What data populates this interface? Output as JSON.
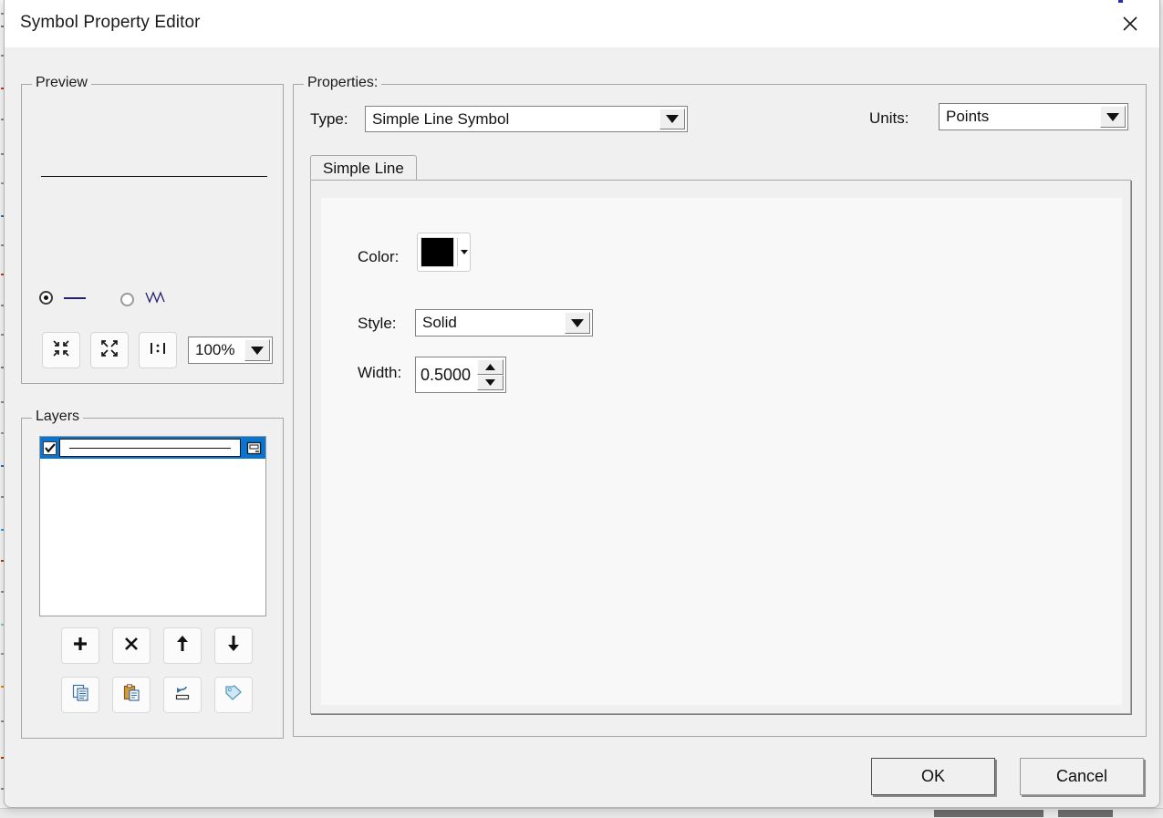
{
  "window": {
    "title": "Symbol Property Editor",
    "close_icon": "close-icon"
  },
  "preview": {
    "legend": "Preview",
    "line_color": "#111111",
    "options": [
      {
        "id": "straight-line",
        "icon": "line-glyph",
        "selected": true
      },
      {
        "id": "zigzag-line",
        "icon": "zigzag-glyph",
        "selected": false
      }
    ],
    "tools": [
      {
        "id": "zoom-out-button",
        "icon": "arrows-inward-icon"
      },
      {
        "id": "zoom-in-button",
        "icon": "arrows-outward-icon"
      },
      {
        "id": "actual-size-button",
        "icon": "one-to-one-icon"
      }
    ],
    "zoom_level": "100%"
  },
  "layers": {
    "legend": "Layers",
    "selected_row_color": "#0a75d1",
    "items": [
      {
        "checked": true,
        "symbol": "line-preview",
        "icon": "layer-properties-icon"
      }
    ],
    "buttons": [
      {
        "id": "add-layer-button",
        "icon": "plus-icon"
      },
      {
        "id": "delete-layer-button",
        "icon": "cross-icon"
      },
      {
        "id": "move-layer-up-button",
        "icon": "arrow-up-icon"
      },
      {
        "id": "move-layer-down-button",
        "icon": "arrow-down-icon"
      },
      {
        "id": "copy-layer-button",
        "icon": "copy-icon"
      },
      {
        "id": "paste-layer-button",
        "icon": "paste-icon"
      },
      {
        "id": "swap-layer-button",
        "icon": "swap-icon"
      },
      {
        "id": "tag-layer-button",
        "icon": "tag-icon"
      }
    ]
  },
  "properties": {
    "legend": "Properties:",
    "type_label": "Type:",
    "type_value": "Simple Line Symbol",
    "units_label": "Units:",
    "units_value": "Points",
    "tabs": [
      {
        "label": "Simple Line",
        "active": true
      }
    ],
    "fields": {
      "color_label": "Color:",
      "color_value": "#000000",
      "style_label": "Style:",
      "style_value": "Solid",
      "width_label": "Width:",
      "width_value": "0.5000"
    }
  },
  "footer": {
    "ok_label": "OK",
    "cancel_label": "Cancel"
  }
}
